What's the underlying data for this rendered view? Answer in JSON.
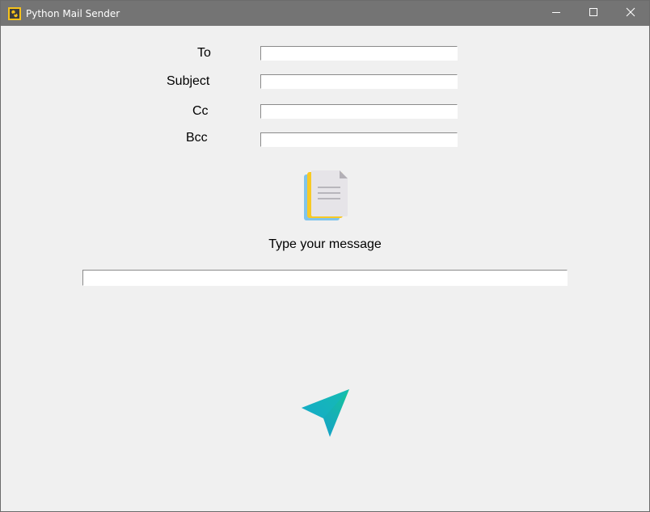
{
  "window": {
    "title": "Python Mail Sender",
    "app_icon": "python-app-icon",
    "controls": [
      "minimize-icon",
      "maximize-icon",
      "close-icon"
    ]
  },
  "form": {
    "to_label": "To",
    "to_value": "",
    "subject_label": "Subject",
    "subject_value": "",
    "cc_label": "Cc",
    "cc_value": "",
    "bcc_label": "Bcc",
    "bcc_value": ""
  },
  "message": {
    "icon": "document-icon",
    "label": "Type your message",
    "value": ""
  },
  "send": {
    "icon": "paper-plane-icon"
  },
  "colors": {
    "titlebar": "#747474",
    "background": "#f0f0f0",
    "plane_gradient_start": "#16c59a",
    "plane_gradient_end": "#1596d8"
  }
}
